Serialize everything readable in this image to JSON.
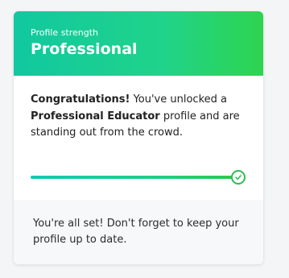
{
  "header": {
    "kicker": "Profile strength",
    "title": "Professional"
  },
  "message": {
    "congrats": "Congratulations!",
    "part1": " You've unlocked a ",
    "level": "Professional Educator",
    "part2": " profile and are standing out from the crowd."
  },
  "progress": {
    "value": 1.0
  },
  "footer": {
    "text": "You're all set! Don't forget to keep your profile up to date."
  },
  "colors": {
    "accent": "#1fd28a",
    "check": "#2ebd52"
  }
}
